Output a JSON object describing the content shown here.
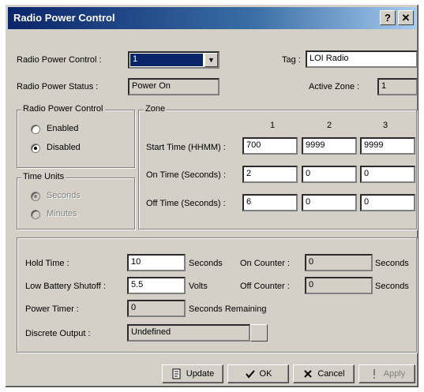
{
  "window": {
    "title": "Radio Power Control",
    "help_label": "?",
    "close_label": "✕"
  },
  "top": {
    "radio_power_control_label": "Radio Power Control :",
    "radio_power_control_value": "1",
    "tag_label": "Tag :",
    "tag_value": "LOI Radio",
    "radio_power_status_label": "Radio Power Status :",
    "radio_power_status_value": "Power On",
    "active_zone_label": "Active Zone :",
    "active_zone_value": "1"
  },
  "rpc_group": {
    "title": "Radio Power Control",
    "enabled_label": "Enabled",
    "disabled_label": "Disabled",
    "selected": "Disabled"
  },
  "time_units": {
    "title": "Time Units",
    "seconds_label": "Seconds",
    "minutes_label": "Minutes",
    "selected": "Seconds"
  },
  "zone": {
    "title": "Zone",
    "columns": [
      "1",
      "2",
      "3"
    ],
    "rows": [
      {
        "label": "Start Time (HHMM) :",
        "values": [
          "700",
          "9999",
          "9999"
        ]
      },
      {
        "label": "On Time (Seconds) :",
        "values": [
          "2",
          "0",
          "0"
        ]
      },
      {
        "label": "Off Time (Seconds) :",
        "values": [
          "6",
          "0",
          "0"
        ]
      }
    ]
  },
  "bottom": {
    "hold_time_label": "Hold Time :",
    "hold_time_value": "10",
    "hold_time_unit": "Seconds",
    "on_counter_label": "On Counter :",
    "on_counter_value": "0",
    "on_counter_unit": "Seconds",
    "low_battery_label": "Low Battery Shutoff :",
    "low_battery_value": "5.5",
    "low_battery_unit": "Volts",
    "off_counter_label": "Off Counter :",
    "off_counter_value": "0",
    "off_counter_unit": "Seconds",
    "power_timer_label": "Power Timer :",
    "power_timer_value": "0",
    "power_timer_unit": "Seconds Remaining",
    "discrete_output_label": "Discrete Output :",
    "discrete_output_value": "Undefined"
  },
  "buttons": {
    "update": "Update",
    "ok": "OK",
    "cancel": "Cancel",
    "apply": "Apply"
  },
  "colors": {
    "title_bar": "#0a246a",
    "dialog_face": "#d4d0c8",
    "selection": "#0a246a"
  }
}
